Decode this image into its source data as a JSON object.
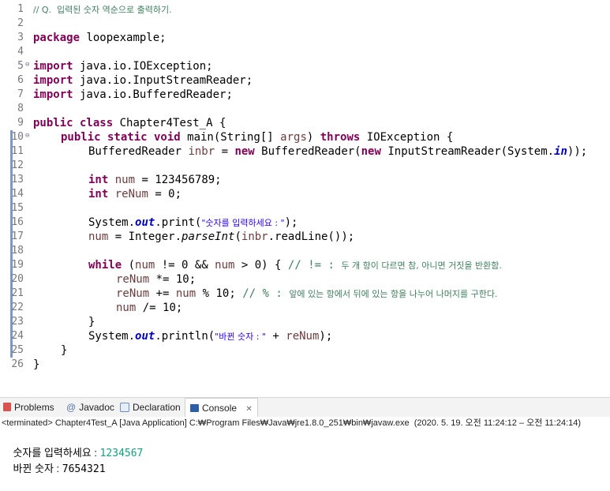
{
  "editor": {
    "line_numbers": [
      "1",
      "2",
      "3",
      "4",
      "5",
      "6",
      "7",
      "8",
      "9",
      "10",
      "11",
      "12",
      "13",
      "14",
      "15",
      "16",
      "17",
      "18",
      "19",
      "20",
      "21",
      "22",
      "23",
      "24",
      "25",
      "26"
    ],
    "l1_comment": "// Q.  입력된 숫자 역순으로 출력하기.",
    "l3_kw": "package",
    "l3_rest": " loopexample;",
    "l5_kw": "import",
    "l5_rest": " java.io.IOException;",
    "l6_kw": "import",
    "l6_rest": " java.io.InputStreamReader;",
    "l7_kw": "import",
    "l7_rest": " java.io.BufferedReader;",
    "l9_kw": "public class",
    "l9_rest": " Chapter4Test_A {",
    "l10_kw1": "public static void",
    "l10_a": " main(String[] ",
    "l10_param": "args",
    "l10_b": ") ",
    "l10_kw2": "throws",
    "l10_c": " IOException {",
    "l11_a": "BufferedReader ",
    "l11_var": "inbr",
    "l11_b": " = ",
    "l11_kw1": "new",
    "l11_c": " BufferedReader(",
    "l11_kw2": "new",
    "l11_d": " InputStreamReader(System.",
    "l11_static": "in",
    "l11_e": "));",
    "l13_kw": "int",
    "l13_var": "num",
    "l13_rest": " = 123456789;",
    "l14_kw": "int",
    "l14_var": "reNum",
    "l14_rest": " = 0;",
    "l16_a": "System.",
    "l16_static": "out",
    "l16_b": ".print(",
    "l16_str": "\"숫자를 입력하세요 : \"",
    "l16_c": ");",
    "l17_var": "num",
    "l17_a": " = Integer.",
    "l17_method": "parseInt",
    "l17_b": "(",
    "l17_var2": "inbr",
    "l17_c": ".readLine());",
    "l19_kw": "while",
    "l19_a": " (",
    "l19_var": "num",
    "l19_b": " != 0 && ",
    "l19_var2": "num",
    "l19_c": " > 0) { ",
    "l19_comment_a": "// != : ",
    "l19_comment_b": "두 개 항이 다르면 참, 아니면 거짓을 반환함.",
    "l20_var": "reNum",
    "l20_rest": " *= 10;",
    "l21_var": "reNum",
    "l21_a": " += ",
    "l21_var2": "num",
    "l21_b": " % 10; ",
    "l21_comment_a": "// % : ",
    "l21_comment_b": "앞에 있는 항에서 뒤에 있는 항을 나누어 나머지를 구한다.",
    "l22_var": "num",
    "l22_rest": " /= 10;",
    "l23": "}",
    "l24_a": "System.",
    "l24_static": "out",
    "l24_b": ".println(",
    "l24_str": "\"바뀐 숫자 : \"",
    "l24_c": " + ",
    "l24_var": "reNum",
    "l24_d": ");",
    "l25": "}",
    "l26": "}"
  },
  "scroll_arrow": "<",
  "tabs": {
    "problems": "Problems",
    "javadoc": "Javadoc",
    "declaration": "Declaration",
    "console": "Console",
    "console_close": "✕",
    "javadoc_prefix": "@"
  },
  "console": {
    "terminated": "<terminated> Chapter4Test_A [Java Application] C:₩Program Files₩Java₩jre1.8.0_251₩bin₩javaw.exe  (2020. 5. 19. 오전 11:24:12 – 오전 11:24:14)",
    "prompt": "숫자를 입력하세요 : ",
    "input": "1234567",
    "result_label": "바뀐 숫자 : ",
    "result_value": "7654321"
  },
  "colors": {
    "keyword": "#7f0055",
    "field": "#0000c0",
    "string": "#2a00ff",
    "comment": "#3f7f5f",
    "console_input": "#13a07d"
  }
}
